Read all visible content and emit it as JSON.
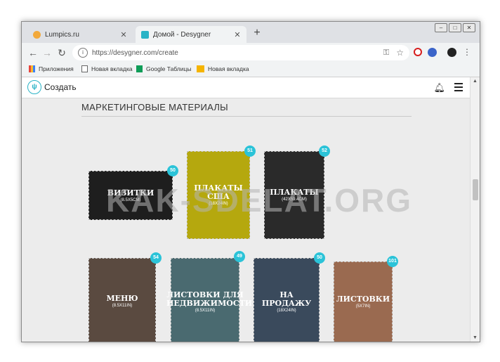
{
  "browser": {
    "tabs": [
      {
        "title": "Lumpics.ru",
        "favicon_color": "#f2a93b"
      },
      {
        "title": "Домой - Desygner",
        "favicon_color": "#2ab3c6"
      }
    ],
    "new_tab_symbol": "+",
    "url": "https://desygner.com/create",
    "bookmarks": [
      {
        "label": "Приложения",
        "icon": "apps-grid-icon"
      },
      {
        "label": "Новая вкладка",
        "icon": "page-icon"
      },
      {
        "label": "Google Таблицы",
        "icon": "sheets-icon"
      },
      {
        "label": "Новая вкладка",
        "icon": "image-icon"
      }
    ]
  },
  "app": {
    "create_label": "Создать",
    "accent_color": "#2bc3d8"
  },
  "section": {
    "title": "МАРКЕТИНГОВЫЕ МАТЕРИАЛЫ"
  },
  "cards": [
    {
      "name": "ВИЗИТКИ",
      "size": "(8.5X5CM)",
      "badge": "50"
    },
    {
      "name": "ПЛАКАТЫ США",
      "size": "(18X24IN)",
      "badge": "51"
    },
    {
      "name": "ПЛАКАТЫ",
      "size": "(42X59.4CM)",
      "badge": "52"
    },
    {
      "name": "МЕНЮ",
      "size": "(8.5X11IN)",
      "badge": "54"
    },
    {
      "name": "ЛИСТОВКИ ДЛЯ НЕДВИЖИМОСТИ",
      "size": "(8.5X11IN)",
      "badge": "49"
    },
    {
      "name": "НА ПРОДАЖУ",
      "size": "(18X24IN)",
      "badge": "50"
    },
    {
      "name": "ЛИСТОВКИ",
      "size": "(5X7IN)",
      "badge": "101"
    }
  ],
  "watermark": "KAK-SDELAT.ORG"
}
